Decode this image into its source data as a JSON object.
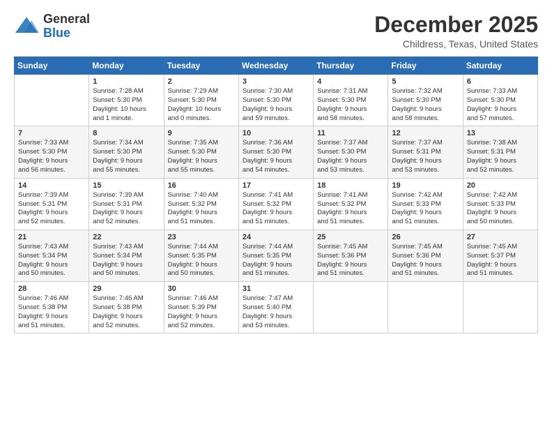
{
  "header": {
    "logo_general": "General",
    "logo_blue": "Blue",
    "month_title": "December 2025",
    "subtitle": "Childress, Texas, United States"
  },
  "days_of_week": [
    "Sunday",
    "Monday",
    "Tuesday",
    "Wednesday",
    "Thursday",
    "Friday",
    "Saturday"
  ],
  "weeks": [
    [
      {
        "day": "",
        "info": ""
      },
      {
        "day": "1",
        "info": "Sunrise: 7:28 AM\nSunset: 5:30 PM\nDaylight: 10 hours\nand 1 minute."
      },
      {
        "day": "2",
        "info": "Sunrise: 7:29 AM\nSunset: 5:30 PM\nDaylight: 10 hours\nand 0 minutes."
      },
      {
        "day": "3",
        "info": "Sunrise: 7:30 AM\nSunset: 5:30 PM\nDaylight: 9 hours\nand 59 minutes."
      },
      {
        "day": "4",
        "info": "Sunrise: 7:31 AM\nSunset: 5:30 PM\nDaylight: 9 hours\nand 58 minutes."
      },
      {
        "day": "5",
        "info": "Sunrise: 7:32 AM\nSunset: 5:30 PM\nDaylight: 9 hours\nand 58 minutes."
      },
      {
        "day": "6",
        "info": "Sunrise: 7:33 AM\nSunset: 5:30 PM\nDaylight: 9 hours\nand 57 minutes."
      }
    ],
    [
      {
        "day": "7",
        "info": "Sunrise: 7:33 AM\nSunset: 5:30 PM\nDaylight: 9 hours\nand 56 minutes."
      },
      {
        "day": "8",
        "info": "Sunrise: 7:34 AM\nSunset: 5:30 PM\nDaylight: 9 hours\nand 55 minutes."
      },
      {
        "day": "9",
        "info": "Sunrise: 7:35 AM\nSunset: 5:30 PM\nDaylight: 9 hours\nand 55 minutes."
      },
      {
        "day": "10",
        "info": "Sunrise: 7:36 AM\nSunset: 5:30 PM\nDaylight: 9 hours\nand 54 minutes."
      },
      {
        "day": "11",
        "info": "Sunrise: 7:37 AM\nSunset: 5:30 PM\nDaylight: 9 hours\nand 53 minutes."
      },
      {
        "day": "12",
        "info": "Sunrise: 7:37 AM\nSunset: 5:31 PM\nDaylight: 9 hours\nand 53 minutes."
      },
      {
        "day": "13",
        "info": "Sunrise: 7:38 AM\nSunset: 5:31 PM\nDaylight: 9 hours\nand 52 minutes."
      }
    ],
    [
      {
        "day": "14",
        "info": "Sunrise: 7:39 AM\nSunset: 5:31 PM\nDaylight: 9 hours\nand 52 minutes."
      },
      {
        "day": "15",
        "info": "Sunrise: 7:39 AM\nSunset: 5:31 PM\nDaylight: 9 hours\nand 52 minutes."
      },
      {
        "day": "16",
        "info": "Sunrise: 7:40 AM\nSunset: 5:32 PM\nDaylight: 9 hours\nand 51 minutes."
      },
      {
        "day": "17",
        "info": "Sunrise: 7:41 AM\nSunset: 5:32 PM\nDaylight: 9 hours\nand 51 minutes."
      },
      {
        "day": "18",
        "info": "Sunrise: 7:41 AM\nSunset: 5:32 PM\nDaylight: 9 hours\nand 51 minutes."
      },
      {
        "day": "19",
        "info": "Sunrise: 7:42 AM\nSunset: 5:33 PM\nDaylight: 9 hours\nand 51 minutes."
      },
      {
        "day": "20",
        "info": "Sunrise: 7:42 AM\nSunset: 5:33 PM\nDaylight: 9 hours\nand 50 minutes."
      }
    ],
    [
      {
        "day": "21",
        "info": "Sunrise: 7:43 AM\nSunset: 5:34 PM\nDaylight: 9 hours\nand 50 minutes."
      },
      {
        "day": "22",
        "info": "Sunrise: 7:43 AM\nSunset: 5:34 PM\nDaylight: 9 hours\nand 50 minutes."
      },
      {
        "day": "23",
        "info": "Sunrise: 7:44 AM\nSunset: 5:35 PM\nDaylight: 9 hours\nand 50 minutes."
      },
      {
        "day": "24",
        "info": "Sunrise: 7:44 AM\nSunset: 5:35 PM\nDaylight: 9 hours\nand 51 minutes."
      },
      {
        "day": "25",
        "info": "Sunrise: 7:45 AM\nSunset: 5:36 PM\nDaylight: 9 hours\nand 51 minutes."
      },
      {
        "day": "26",
        "info": "Sunrise: 7:45 AM\nSunset: 5:36 PM\nDaylight: 9 hours\nand 51 minutes."
      },
      {
        "day": "27",
        "info": "Sunrise: 7:45 AM\nSunset: 5:37 PM\nDaylight: 9 hours\nand 51 minutes."
      }
    ],
    [
      {
        "day": "28",
        "info": "Sunrise: 7:46 AM\nSunset: 5:38 PM\nDaylight: 9 hours\nand 51 minutes."
      },
      {
        "day": "29",
        "info": "Sunrise: 7:46 AM\nSunset: 5:38 PM\nDaylight: 9 hours\nand 52 minutes."
      },
      {
        "day": "30",
        "info": "Sunrise: 7:46 AM\nSunset: 5:39 PM\nDaylight: 9 hours\nand 52 minutes."
      },
      {
        "day": "31",
        "info": "Sunrise: 7:47 AM\nSunset: 5:40 PM\nDaylight: 9 hours\nand 53 minutes."
      },
      {
        "day": "",
        "info": ""
      },
      {
        "day": "",
        "info": ""
      },
      {
        "day": "",
        "info": ""
      }
    ]
  ]
}
